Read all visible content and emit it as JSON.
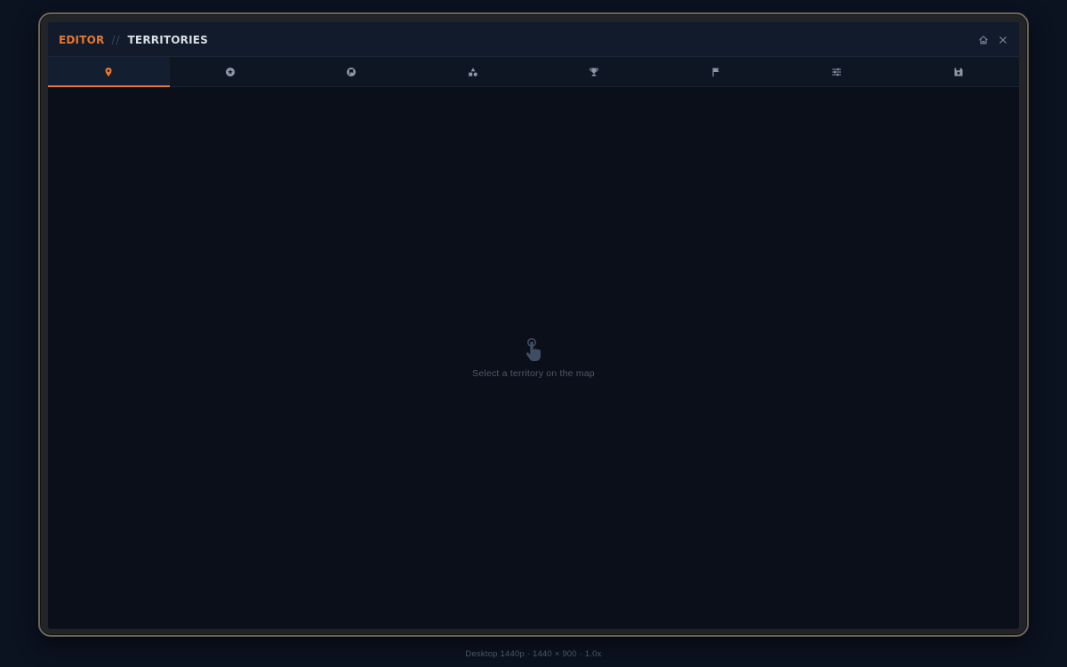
{
  "window": {
    "breadcrumb": {
      "section": "EDITOR",
      "separator": "//",
      "page": "TERRITORIES"
    },
    "controls": [
      {
        "name": "home-icon"
      },
      {
        "name": "close-icon"
      }
    ]
  },
  "tabs": [
    {
      "icon": "map-pin-icon",
      "active": true
    },
    {
      "icon": "star-badge-icon",
      "active": false
    },
    {
      "icon": "flag-circle-icon",
      "active": false
    },
    {
      "icon": "shapes-icon",
      "active": false
    },
    {
      "icon": "trophy-icon",
      "active": false
    },
    {
      "icon": "flag-icon",
      "active": false
    },
    {
      "icon": "sliders-icon",
      "active": false
    },
    {
      "icon": "save-icon",
      "active": false
    }
  ],
  "empty_state": {
    "icon": "pointer-hand-icon",
    "message": "Select a territory on the map"
  },
  "footer": {
    "text": "Desktop 1440p  ·  1440 × 900 · 1.0x"
  },
  "colors": {
    "accent": "#e5782f",
    "icon_muted": "#8c97a8",
    "background": "#0a0f1a"
  }
}
